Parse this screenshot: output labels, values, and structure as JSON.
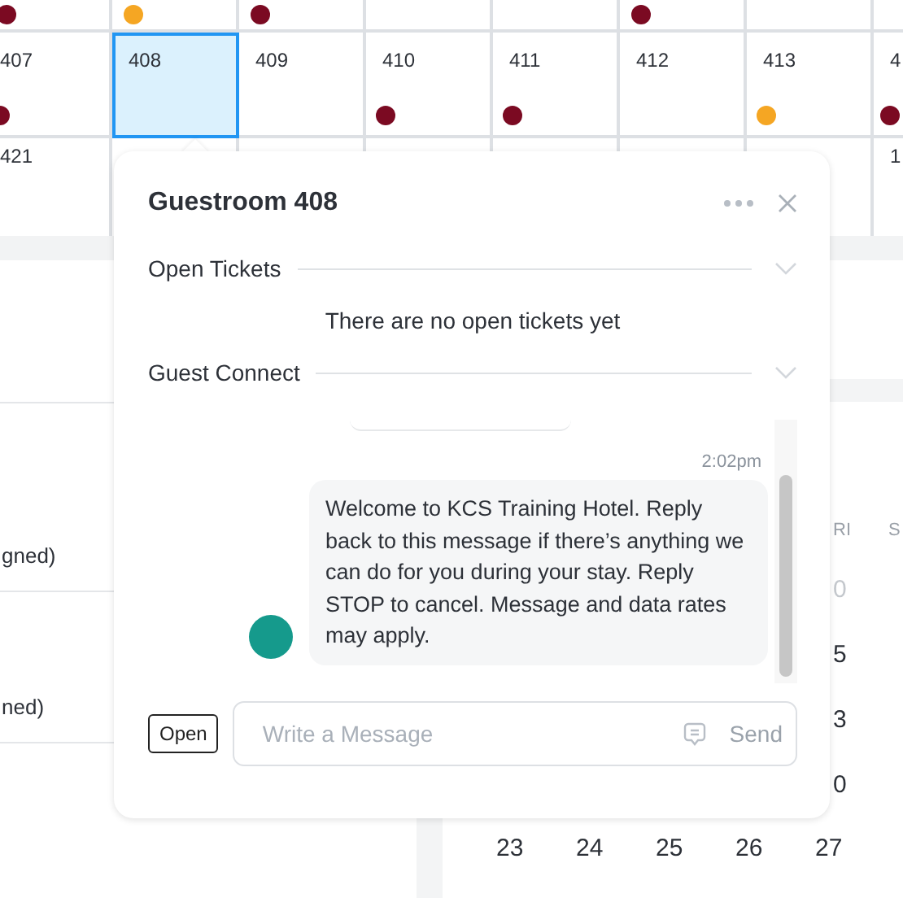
{
  "room_grid": {
    "rows": [
      {
        "cells": [
          {
            "color": "#7b0a22"
          },
          {
            "color": "#f5a623"
          },
          {
            "color": "#7b0a22"
          },
          {},
          {},
          {
            "color": "#7b0a22"
          },
          {},
          {}
        ]
      },
      {
        "cells": [
          {
            "number": "407",
            "color": "#7b0a22",
            "selected": false
          },
          {
            "number": "408",
            "selected": true
          },
          {
            "number": "409",
            "selected": false
          },
          {
            "number": "410",
            "color": "#7b0a22",
            "selected": false
          },
          {
            "number": "411",
            "color": "#7b0a22",
            "selected": false
          },
          {
            "number": "412",
            "selected": false
          },
          {
            "number": "413",
            "color": "#f5a623",
            "selected": false
          },
          {
            "number": "4",
            "color": "#7b0a22",
            "selected": false
          }
        ]
      },
      {
        "cells": [
          {
            "number": "421"
          },
          {},
          {},
          {},
          {},
          {},
          {},
          {
            "number": "1"
          }
        ]
      }
    ]
  },
  "left_list": {
    "items": [
      "gned)",
      "ned)"
    ]
  },
  "calendar": {
    "headers": [
      "RI",
      "S"
    ],
    "rows": [
      [
        "0"
      ],
      [
        "5"
      ],
      [
        "3"
      ],
      [
        "0"
      ]
    ],
    "last_row": [
      "23",
      "24",
      "25",
      "26",
      "27"
    ]
  },
  "popover": {
    "title": "Guestroom 408",
    "sections": [
      {
        "title": "Open Tickets",
        "empty_text": "There are no open tickets yet"
      },
      {
        "title": "Guest Connect"
      }
    ],
    "messages": [
      {
        "time": "2:02pm",
        "text": "Welcome to KCS Training Hotel. Reply back to this message if there’s anything we can do for you during your stay. Reply STOP to cancel. Message and data rates may apply.",
        "color": "#159a8c"
      }
    ],
    "open_button": "Open",
    "message_field": {
      "placeholder": "Write a Message"
    },
    "send_button": "Send"
  }
}
